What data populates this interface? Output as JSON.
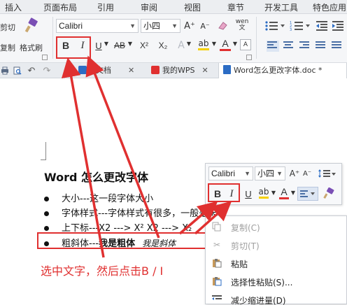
{
  "menu": {
    "items": [
      "插入",
      "页面布局",
      "引用",
      "审阅",
      "视图",
      "章节",
      "开发工具",
      "特色应用"
    ]
  },
  "ribbon": {
    "cut_label": "剪切",
    "copy_label": "复制",
    "format_painter_label": "格式刷",
    "font_name": "Calibri",
    "font_size": "小四",
    "bold_label": "B",
    "italic_label": "I",
    "underline_label": "U",
    "strike_label": "AB",
    "superscript_label": "X²",
    "subscript_label": "X₂",
    "grow_font_label": "A⁺",
    "shrink_font_label": "A⁻",
    "font_color_label": "A",
    "highlight_label": "ab",
    "phonetic_label": "wen"
  },
  "tabs": [
    {
      "label": "云文档"
    },
    {
      "label": "我的WPS"
    },
    {
      "label": "Word怎么更改字体.doc *"
    }
  ],
  "document": {
    "title": "Word 怎么更改字体",
    "items": [
      "大小---这一段字体大小",
      "字体样式---字体样式有很多，一般是宋体",
      "上下标---X2 ---> X²   X2 ---> X₂"
    ],
    "last_item_prefix": "粗斜体---",
    "last_item_bold": "我是粗体",
    "last_item_italic": "我是斜体",
    "caption": "选中文字，然后点击B / I"
  },
  "mini_toolbar": {
    "font_name": "Calibri",
    "font_size": "小四",
    "bold_label": "B",
    "italic_label": "I"
  },
  "context_menu": {
    "items": [
      {
        "label": "复制(C)",
        "icon": "copy-icon",
        "disabled": true
      },
      {
        "label": "剪切(T)",
        "icon": "scissors-icon",
        "disabled": true
      },
      {
        "label": "粘贴",
        "icon": "paste-icon",
        "disabled": false
      },
      {
        "label": "选择性粘贴(S)...",
        "icon": "paste-special-icon",
        "disabled": false
      },
      {
        "label": "减少缩进量(D)",
        "icon": "decrease-indent-icon",
        "disabled": false
      }
    ]
  },
  "colors": {
    "annotation_red": "#e03030",
    "font_color_red": "#e03030",
    "highlight_yellow": "#f5d000",
    "accent_blue": "#2b6cc4"
  }
}
